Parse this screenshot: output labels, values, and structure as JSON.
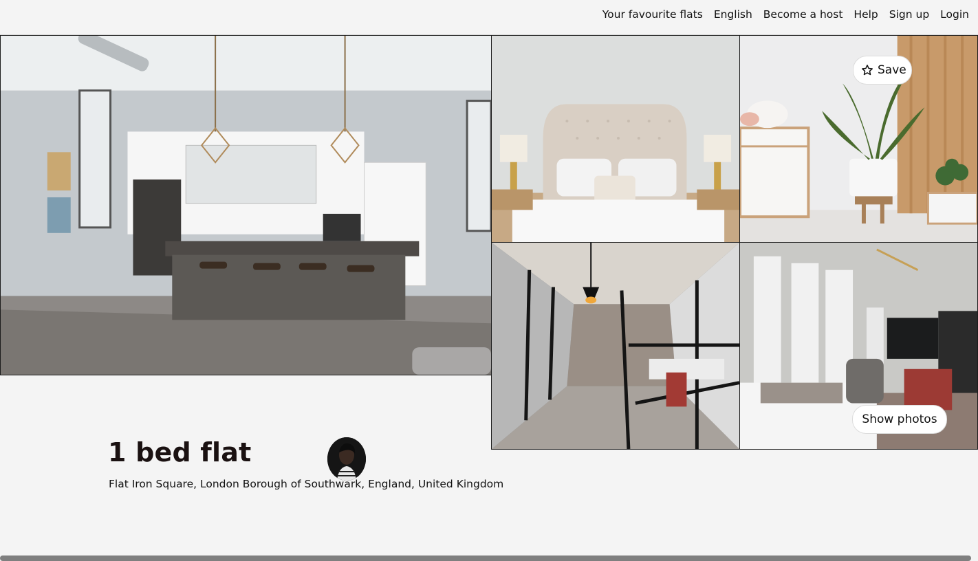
{
  "nav": {
    "links": [
      "Your favourite flats",
      "English",
      "Become a host",
      "Help",
      "Sign up",
      "Login"
    ]
  },
  "gallery": {
    "photos": [
      {
        "name": "kitchen-photo",
        "alt": "Open plan kitchen with island"
      },
      {
        "name": "bedroom-photo",
        "alt": "Bedroom with tufted headboard"
      },
      {
        "name": "plant-photo",
        "alt": "Snake plant on stool"
      },
      {
        "name": "hallway-photo",
        "alt": "Glass walled hallway"
      },
      {
        "name": "living-photo",
        "alt": "Bedroom with TV and chairs"
      }
    ],
    "save_label": "Save",
    "show_photos_label": "Show photos"
  },
  "listing": {
    "title": "1 bed flat",
    "address": "Flat Iron Square, London Borough of Southwark, England, United Kingdom"
  },
  "icons": {
    "save": "star-icon"
  }
}
